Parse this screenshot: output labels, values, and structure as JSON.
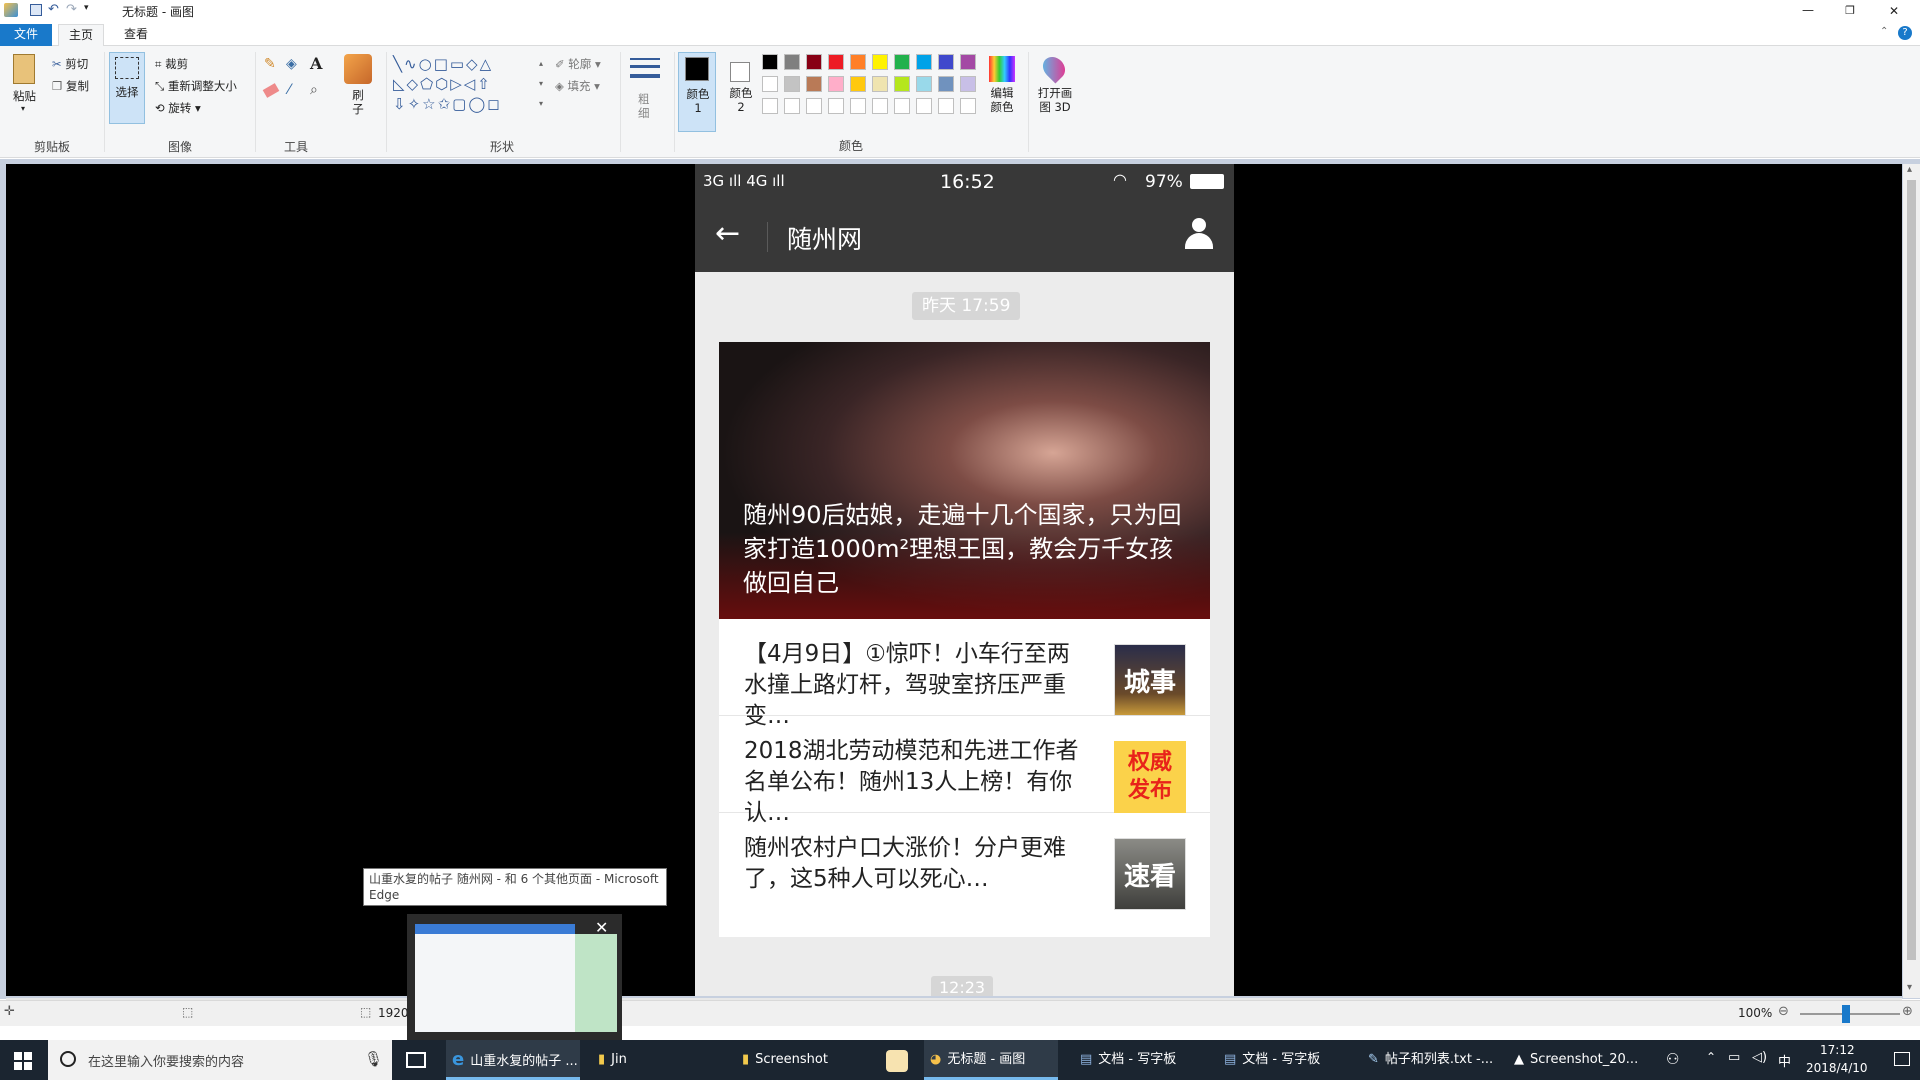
{
  "window": {
    "title": "无标题 - 画图"
  },
  "ribbon_tabs": [
    "文件",
    "主页",
    "查看"
  ],
  "clipboard": {
    "paste": "粘贴",
    "cut": "剪切",
    "copy": "复制",
    "label": "剪贴板"
  },
  "image": {
    "select": "选择",
    "crop": "裁剪",
    "resize": "重新调整大小",
    "rotate": "旋转",
    "label": "图像"
  },
  "tools": {
    "label": "工具",
    "brush": "刷子"
  },
  "shapes": {
    "outline": "轮廓",
    "fill": "填充",
    "label": "形状"
  },
  "size": {
    "label": "粗细"
  },
  "colors": {
    "color1": "颜色 1",
    "color2": "颜色 2",
    "edit": "编辑颜色",
    "paint3d": "打开画图 3D",
    "label": "颜色"
  },
  "palette_row1": [
    "#000000",
    "#7f7f7f",
    "#880015",
    "#ed1c24",
    "#ff7f27",
    "#fff200",
    "#22b14c",
    "#00a2e8",
    "#3f48cc",
    "#a349a4"
  ],
  "palette_row2": [
    "#ffffff",
    "#c3c3c3",
    "#b97a57",
    "#ffaec9",
    "#ffc90e",
    "#efe4b0",
    "#b5e61d",
    "#99d9ea",
    "#7092be",
    "#c8bfe7"
  ],
  "phone": {
    "status": {
      "left": "3G ıll 4G ıll",
      "time": "16:52",
      "battery": "97%"
    },
    "nav": {
      "title": "随州网"
    },
    "timestamp": "昨天 17:59",
    "hero": {
      "title": "随州90后姑娘，走遍十几个国家，只为回家打造1000m²理想王国，教会万千女孩做回自己"
    },
    "news": [
      {
        "title": "【4月9日】①惊吓！小车行至两水撞上路灯杆，驾驶室挤压严重变…",
        "thumb": "城事"
      },
      {
        "title": "2018湖北劳动模范和先进工作者名单公布！随州13人上榜！有你认…",
        "thumb": "权威发布"
      },
      {
        "title": "随州农村户口大涨价！分户更难了，这5种人可以死心…",
        "thumb": "速看"
      }
    ],
    "next_time": "12:23"
  },
  "tooltip": {
    "text": "山重水复的帖子 随州网 - 和 6 个其他页面 - Microsoft Edge"
  },
  "status": {
    "size_prefix": "1920",
    "zoom": "100%"
  },
  "taskbar": {
    "search_placeholder": "在这里输入你要搜索的内容",
    "items": [
      {
        "label": "山重水复的帖子 ..."
      },
      {
        "label": "Jin"
      },
      {
        "label": "Screenshot"
      },
      {
        "label": "无标题 - 画图"
      },
      {
        "label": "文档 - 写字板"
      },
      {
        "label": "文档 - 写字板"
      },
      {
        "label": "帖子和列表.txt -..."
      },
      {
        "label": "Screenshot_20..."
      }
    ],
    "ime": "中",
    "clock_time": "17:12",
    "clock_date": "2018/4/10"
  }
}
